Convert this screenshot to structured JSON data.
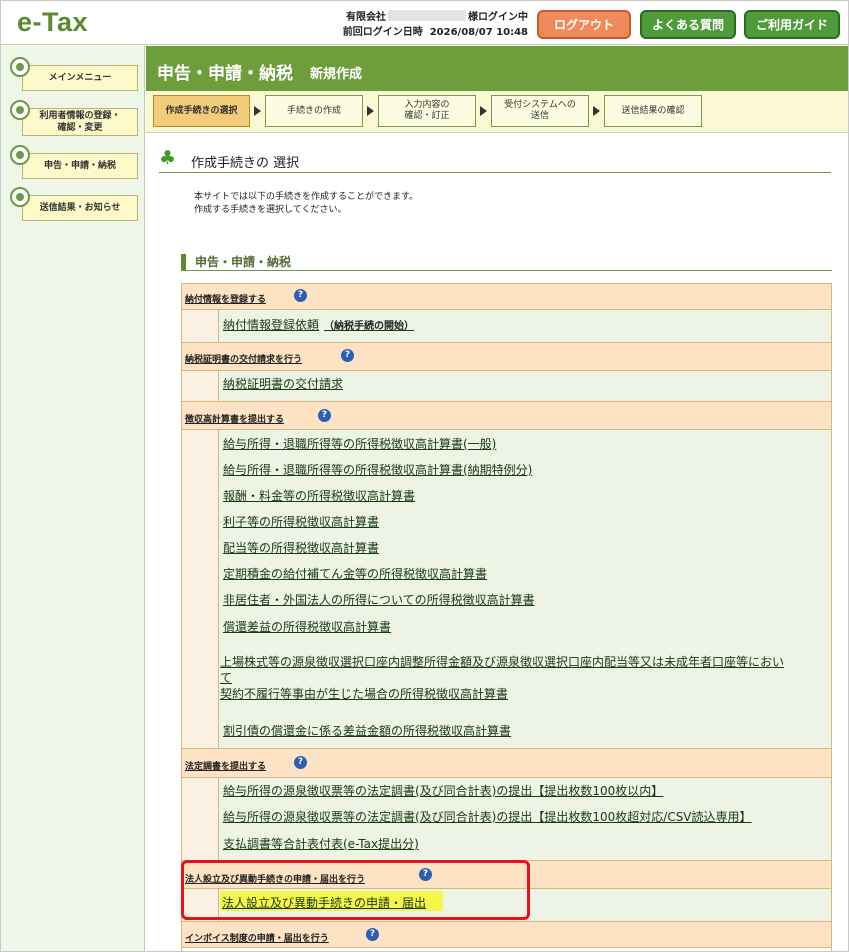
{
  "header": {
    "logo": "e-Tax",
    "company_prefix": "有限会社",
    "login_status": "様ログイン中",
    "last_login_label": "前回ログイン日時",
    "last_login_time": "2026/08/07 10:48",
    "logout_label": "ログアウト",
    "faq_label": "よくある質問",
    "guide_label": "ご利用ガイド"
  },
  "sidebar": {
    "items": [
      {
        "label": "メインメニュー"
      },
      {
        "label_line1": "利用者情報の登録・",
        "label_line2": "確認・変更"
      },
      {
        "label": "申告・申請・納税"
      },
      {
        "label": "送信結果・お知らせ"
      }
    ]
  },
  "page": {
    "title": "申告・申請・納税",
    "subtitle": "新規作成"
  },
  "steps": [
    {
      "label": "作成手続きの選択"
    },
    {
      "label": "手続きの作成"
    },
    {
      "line1": "入力内容の",
      "line2": "確認・訂正"
    },
    {
      "line1": "受付システムへの",
      "line2": "送信"
    },
    {
      "label": "送信結果の確認"
    }
  ],
  "section": {
    "title": "作成手続きの 選択",
    "intro_line1": "本サイトでは以下の手続きを作成することができます。",
    "intro_line2": "作成する手続きを選択してください。"
  },
  "category": {
    "title": "申告・申請・納税"
  },
  "groups": [
    {
      "heading": "納付情報を登録する",
      "items": [
        {
          "label": "納付情報登録依頼",
          "note": "（納税手続の開始）"
        }
      ]
    },
    {
      "heading": "納税証明書の交付請求を行う",
      "items": [
        {
          "label": "納税証明書の交付請求"
        }
      ]
    },
    {
      "heading": "徴収高計算書を提出する",
      "items": [
        {
          "label": "給与所得・退職所得等の所得税徴収高計算書(一般)"
        },
        {
          "label": "給与所得・退職所得等の所得税徴収高計算書(納期特例分)"
        },
        {
          "label": "報酬・料金等の所得税徴収高計算書"
        },
        {
          "label": "利子等の所得税徴収高計算書"
        },
        {
          "label": "配当等の所得税徴収高計算書"
        },
        {
          "label": "定期積金の給付補てん金等の所得税徴収高計算書"
        },
        {
          "label": "非居住者・外国法人の所得についての所得税徴収高計算書"
        },
        {
          "label": "償還差益の所得税徴収高計算書"
        },
        {
          "line1": "上場株式等の源泉徴収選択口座内調整所得金額及び源泉徴収選択口座内配当等又は未成年者口座等におい",
          "line2": "て"
        },
        {
          "label": "契約不履行等事由が生じた場合の所得税徴収高計算書"
        },
        {
          "label": "割引債の償還金に係る差益金額の所得税徴収高計算書"
        }
      ]
    },
    {
      "heading": "法定調書を提出する",
      "items": [
        {
          "label": "給与所得の源泉徴収票等の法定調書(及び同合計表)の提出【提出枚数100枚以内】"
        },
        {
          "label": "給与所得の源泉徴収票等の法定調書(及び同合計表)の提出【提出枚数100枚超対応/CSV読込専用】"
        },
        {
          "label": "支払調書等合計表付表(e-Tax提出分)"
        }
      ]
    },
    {
      "heading": "法人設立及び異動手続きの申請・届出を行う",
      "items": [
        {
          "label": "法人設立及び異動手続きの申請・届出"
        }
      ]
    },
    {
      "heading": "インボイス制度の申請・届出を行う",
      "items": []
    }
  ],
  "colors": {
    "brand_green": "#6e9e3c",
    "logout_orange": "#f08a5a",
    "highlight_red": "#e8101a",
    "highlight_yellow": "#f4f74a"
  }
}
